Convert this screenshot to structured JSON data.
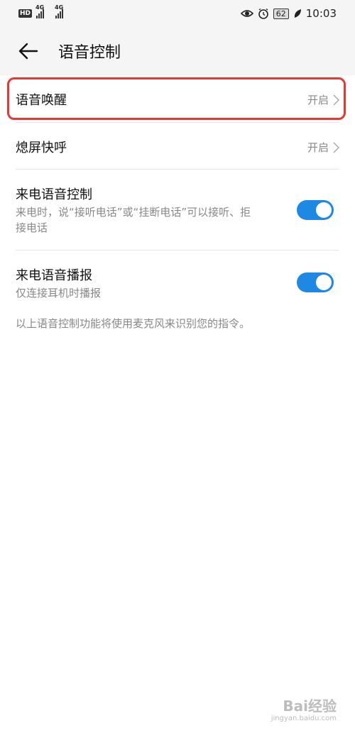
{
  "status_bar": {
    "hd_label": "HD",
    "sim1_network": "4G",
    "sim2_network": "4G",
    "battery_level": "62",
    "time": "10:03"
  },
  "header": {
    "title": "语音控制"
  },
  "settings": [
    {
      "label": "语音唤醒",
      "value": "开启"
    },
    {
      "label": "熄屏快呼",
      "value": "开启"
    },
    {
      "label": "来电语音控制",
      "sub": "来电时，说“接听电话”或“挂断电话”可以接听、拒接电话",
      "toggle_on": true
    },
    {
      "label": "来电语音播报",
      "sub": "仅连接耳机时播报",
      "toggle_on": true
    }
  ],
  "footer_note": "以上语音控制功能将使用麦克风来识别您的指令。",
  "watermark": {
    "main": "Bai经验",
    "sub": "jingyan.baidu.com"
  },
  "colors": {
    "accent": "#1e88e5",
    "highlight": "#e53935"
  }
}
